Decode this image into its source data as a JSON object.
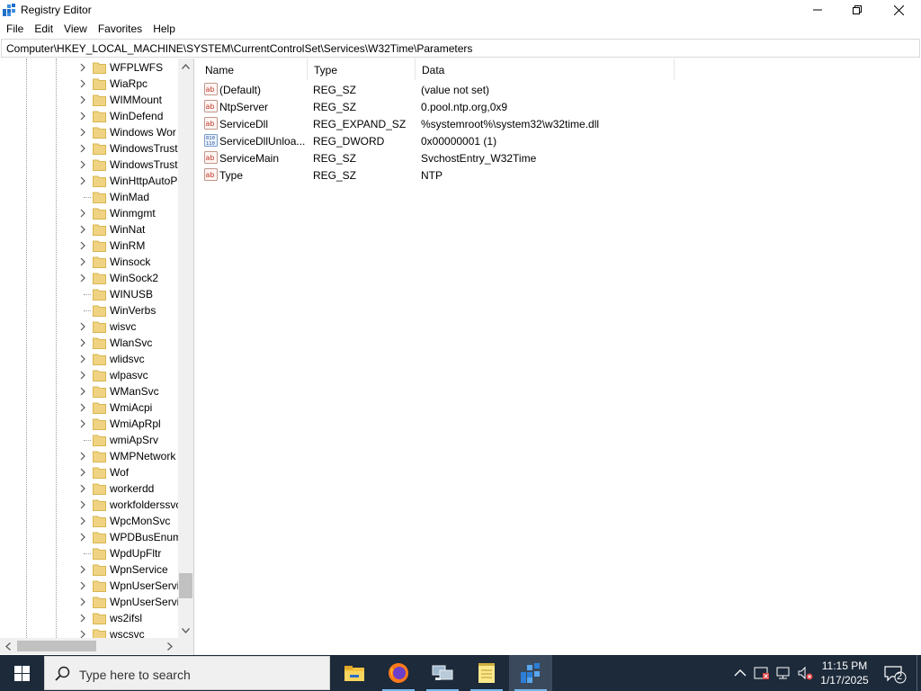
{
  "window": {
    "title": "Registry Editor",
    "address": "Computer\\HKEY_LOCAL_MACHINE\\SYSTEM\\CurrentControlSet\\Services\\W32Time\\Parameters"
  },
  "menu": [
    "File",
    "Edit",
    "View",
    "Favorites",
    "Help"
  ],
  "tree": {
    "items": [
      {
        "label": "WFPLWFS",
        "expandable": true
      },
      {
        "label": "WiaRpc",
        "expandable": true
      },
      {
        "label": "WIMMount",
        "expandable": true
      },
      {
        "label": "WinDefend",
        "expandable": true
      },
      {
        "label": "Windows Wor",
        "expandable": true
      },
      {
        "label": "WindowsTrust",
        "expandable": true
      },
      {
        "label": "WindowsTrust",
        "expandable": true
      },
      {
        "label": "WinHttpAutoP",
        "expandable": true
      },
      {
        "label": "WinMad",
        "expandable": false
      },
      {
        "label": "Winmgmt",
        "expandable": true
      },
      {
        "label": "WinNat",
        "expandable": true
      },
      {
        "label": "WinRM",
        "expandable": true
      },
      {
        "label": "Winsock",
        "expandable": true
      },
      {
        "label": "WinSock2",
        "expandable": true
      },
      {
        "label": "WINUSB",
        "expandable": false
      },
      {
        "label": "WinVerbs",
        "expandable": false
      },
      {
        "label": "wisvc",
        "expandable": true
      },
      {
        "label": "WlanSvc",
        "expandable": true
      },
      {
        "label": "wlidsvc",
        "expandable": true
      },
      {
        "label": "wlpasvc",
        "expandable": true
      },
      {
        "label": "WManSvc",
        "expandable": true
      },
      {
        "label": "WmiAcpi",
        "expandable": true
      },
      {
        "label": "WmiApRpl",
        "expandable": true
      },
      {
        "label": "wmiApSrv",
        "expandable": false
      },
      {
        "label": "WMPNetwork",
        "expandable": true
      },
      {
        "label": "Wof",
        "expandable": true
      },
      {
        "label": "workerdd",
        "expandable": true
      },
      {
        "label": "workfolderssvc",
        "expandable": true
      },
      {
        "label": "WpcMonSvc",
        "expandable": true
      },
      {
        "label": "WPDBusEnum",
        "expandable": true
      },
      {
        "label": "WpdUpFltr",
        "expandable": false
      },
      {
        "label": "WpnService",
        "expandable": true
      },
      {
        "label": "WpnUserServic",
        "expandable": true
      },
      {
        "label": "WpnUserServic",
        "expandable": true
      },
      {
        "label": "ws2ifsl",
        "expandable": true
      },
      {
        "label": "wscsvc",
        "expandable": true
      }
    ]
  },
  "list": {
    "columns": [
      "Name",
      "Type",
      "Data"
    ],
    "rows": [
      {
        "name": "(Default)",
        "type": "REG_SZ",
        "data": "(value not set)",
        "icon": "string-value-icon"
      },
      {
        "name": "NtpServer",
        "type": "REG_SZ",
        "data": "0.pool.ntp.org,0x9",
        "icon": "string-value-icon"
      },
      {
        "name": "ServiceDll",
        "type": "REG_EXPAND_SZ",
        "data": "%systemroot%\\system32\\w32time.dll",
        "icon": "string-value-icon"
      },
      {
        "name": "ServiceDllUnloa...",
        "type": "REG_DWORD",
        "data": "0x00000001 (1)",
        "icon": "binary-value-icon"
      },
      {
        "name": "ServiceMain",
        "type": "REG_SZ",
        "data": "SvchostEntry_W32Time",
        "icon": "string-value-icon"
      },
      {
        "name": "Type",
        "type": "REG_SZ",
        "data": "NTP",
        "icon": "string-value-icon"
      }
    ]
  },
  "taskbar": {
    "search_placeholder": "Type here to search",
    "apps": [
      {
        "name": "file-explorer-icon",
        "running": false,
        "active": false
      },
      {
        "name": "firefox-icon",
        "running": true,
        "active": false
      },
      {
        "name": "network-app-icon",
        "running": true,
        "active": false
      },
      {
        "name": "notepad-icon",
        "running": true,
        "active": false
      },
      {
        "name": "registry-editor-icon",
        "running": true,
        "active": true
      }
    ],
    "time": "11:15 PM",
    "date": "1/17/2025",
    "notification_count": "2"
  },
  "colors": {
    "folder": "#f0d382",
    "taskbar": "#1c2a3a",
    "accent": "#76b9ed"
  }
}
